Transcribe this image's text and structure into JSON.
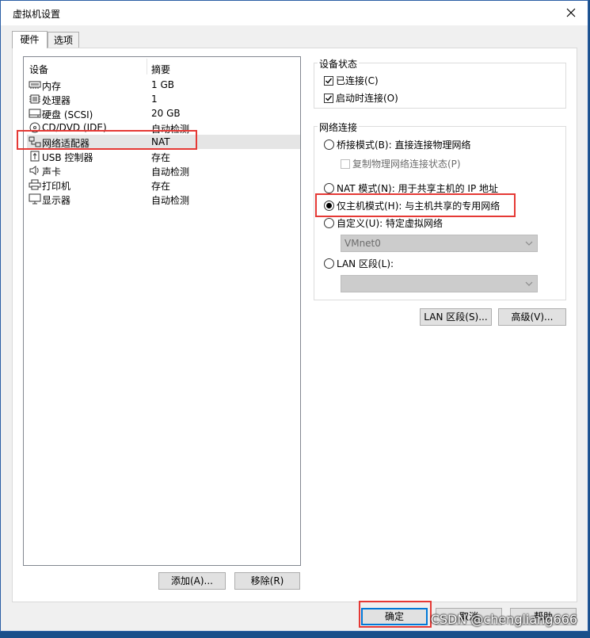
{
  "window": {
    "title": "虚拟机设置"
  },
  "tabs": [
    {
      "label": "硬件",
      "active": true
    },
    {
      "label": "选项",
      "active": false
    }
  ],
  "device_list": {
    "columns": [
      "设备",
      "摘要"
    ],
    "rows": [
      {
        "name": "内存",
        "summary": "1 GB",
        "icon": "memory-icon"
      },
      {
        "name": "处理器",
        "summary": "1",
        "icon": "processor-icon"
      },
      {
        "name": "硬盘 (SCSI)",
        "summary": "20 GB",
        "icon": "hard-disk-icon"
      },
      {
        "name": "CD/DVD (IDE)",
        "summary": "自动检测",
        "icon": "cd-dvd-icon"
      },
      {
        "name": "网络适配器",
        "summary": "NAT",
        "icon": "network-adapter-icon",
        "selected": true
      },
      {
        "name": "USB 控制器",
        "summary": "存在",
        "icon": "usb-icon"
      },
      {
        "name": "声卡",
        "summary": "自动检测",
        "icon": "sound-card-icon"
      },
      {
        "name": "打印机",
        "summary": "存在",
        "icon": "printer-icon"
      },
      {
        "name": "显示器",
        "summary": "自动检测",
        "icon": "display-icon"
      }
    ],
    "add_label": "添加(A)...",
    "remove_label": "移除(R)"
  },
  "device_status": {
    "title": "设备状态",
    "connected": {
      "label": "已连接(C)",
      "checked": true
    },
    "connect_on_power_on": {
      "label": "启动时连接(O)",
      "checked": true
    }
  },
  "network_connection": {
    "title": "网络连接",
    "bridged": {
      "label": "桥接模式(B): 直接连接物理网络",
      "selected": false
    },
    "replicate": {
      "label": "复制物理网络连接状态(P)",
      "checked": false,
      "disabled": true
    },
    "nat": {
      "label": "NAT 模式(N): 用于共享主机的 IP 地址",
      "selected": false
    },
    "host_only": {
      "label": "仅主机模式(H): 与主机共享的专用网络",
      "selected": true
    },
    "custom": {
      "label": "自定义(U): 特定虚拟网络",
      "selected": false
    },
    "custom_select_value": "VMnet0",
    "lan_segment": {
      "label": "LAN 区段(L):",
      "selected": false
    },
    "lan_select_value": ""
  },
  "buttons": {
    "lan_segments": "LAN 区段(S)...",
    "advanced": "高级(V)...",
    "ok": "确定",
    "cancel": "取消",
    "help": "帮助"
  },
  "watermark": "CSDN @chengliang666",
  "colors": {
    "highlight": "#e53935",
    "focus": "#0078d7",
    "selection": "#e5e5e5"
  }
}
